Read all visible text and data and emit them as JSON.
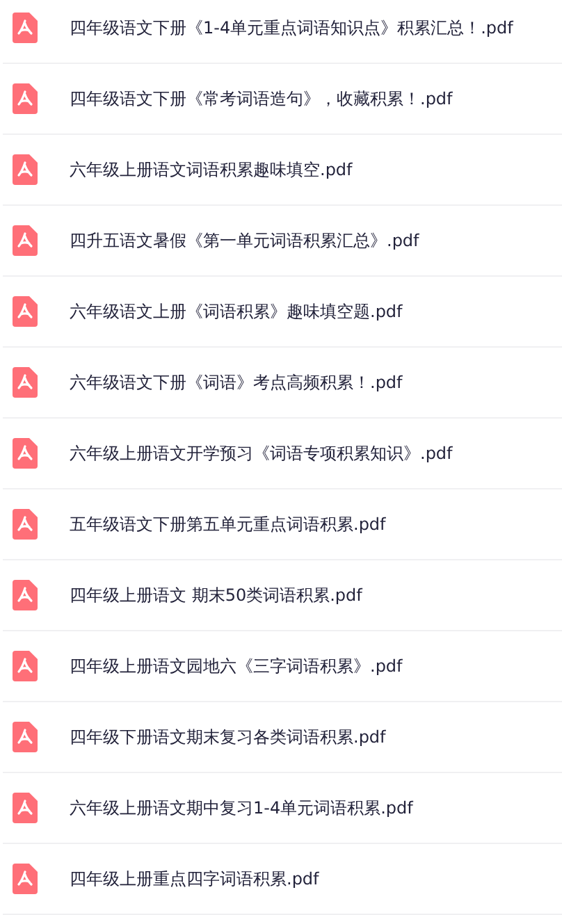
{
  "files": [
    {
      "name": "四年级语文下册《1-4单元重点词语知识点》积累汇总！.pdf",
      "kind": "pdf"
    },
    {
      "name": "四年级语文下册《常考词语造句》，收藏积累！.pdf",
      "kind": "pdf"
    },
    {
      "name": "六年级上册语文词语积累趣味填空.pdf",
      "kind": "pdf"
    },
    {
      "name": "四升五语文暑假《第一单元词语积累汇总》.pdf",
      "kind": "pdf"
    },
    {
      "name": "六年级语文上册《词语积累》趣味填空题.pdf",
      "kind": "pdf"
    },
    {
      "name": "六年级语文下册《词语》考点高频积累！.pdf",
      "kind": "pdf"
    },
    {
      "name": "六年级上册语文开学预习《词语专项积累知识》.pdf",
      "kind": "pdf"
    },
    {
      "name": "五年级语文下册第五单元重点词语积累.pdf",
      "kind": "pdf"
    },
    {
      "name": "四年级上册语文 期末50类词语积累.pdf",
      "kind": "pdf"
    },
    {
      "name": "四年级上册语文园地六《三字词语积累》.pdf",
      "kind": "pdf"
    },
    {
      "name": "四年级下册语文期末复习各类词语积累.pdf",
      "kind": "pdf"
    },
    {
      "name": "六年级上册语文期中复习1-4单元词语积累.pdf",
      "kind": "pdf"
    },
    {
      "name": "四年级上册重点四字词语积累.pdf",
      "kind": "pdf"
    }
  ]
}
